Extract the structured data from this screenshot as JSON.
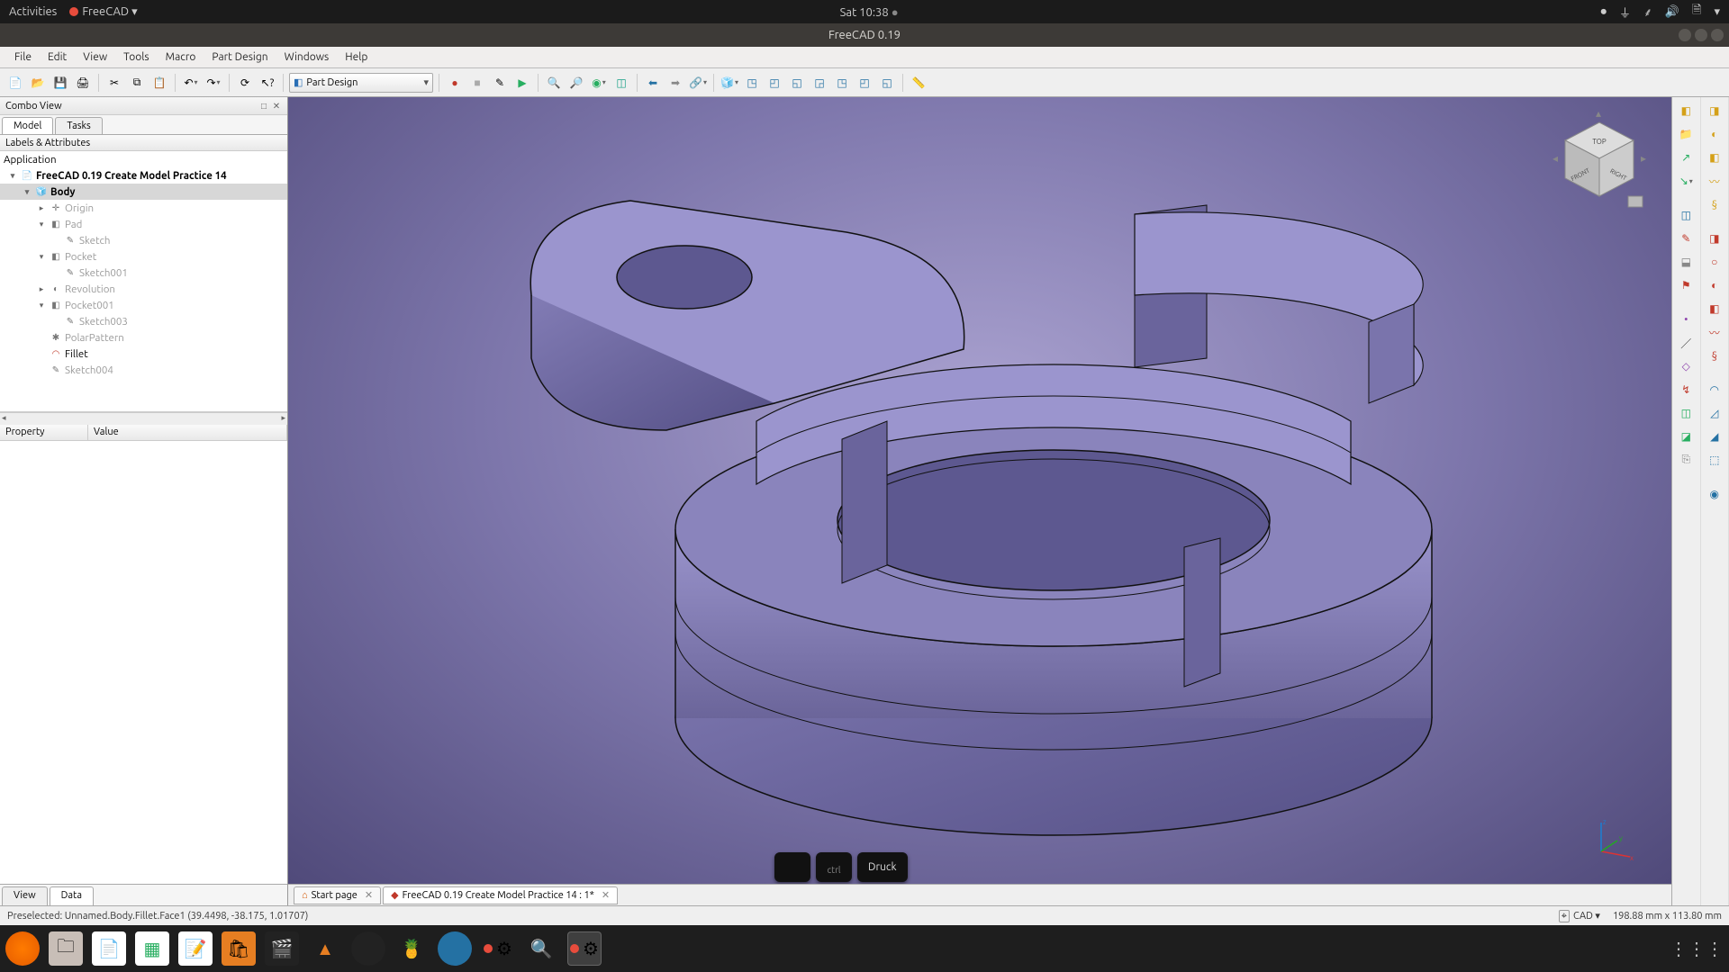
{
  "gnome": {
    "activities": "Activities",
    "app": "FreeCAD",
    "clock": "Sat 10:38"
  },
  "titlebar": {
    "title": "FreeCAD 0.19"
  },
  "menubar": [
    "File",
    "Edit",
    "View",
    "Tools",
    "Macro",
    "Part Design",
    "Windows",
    "Help"
  ],
  "workbench": {
    "selected": "Part Design"
  },
  "combo": {
    "title": "Combo View",
    "tabs": [
      "Model",
      "Tasks"
    ],
    "active_tab": 0,
    "labels_header": "Labels & Attributes",
    "application_label": "Application",
    "tree": [
      {
        "depth": 0,
        "label": "FreeCAD 0.19 Create Model Practice 14",
        "bold": true,
        "exp": "▾",
        "ico": "📄"
      },
      {
        "depth": 1,
        "label": "Body",
        "bold": true,
        "sel": true,
        "exp": "▾",
        "ico": "🧊"
      },
      {
        "depth": 2,
        "label": "Origin",
        "greyed": true,
        "exp": "▸",
        "ico": "✛"
      },
      {
        "depth": 2,
        "label": "Pad",
        "greyed": true,
        "exp": "▾",
        "ico": "◧"
      },
      {
        "depth": 3,
        "label": "Sketch",
        "greyed": true,
        "ico": "✎"
      },
      {
        "depth": 2,
        "label": "Pocket",
        "greyed": true,
        "exp": "▾",
        "ico": "◧"
      },
      {
        "depth": 3,
        "label": "Sketch001",
        "greyed": true,
        "ico": "✎"
      },
      {
        "depth": 2,
        "label": "Revolution",
        "greyed": true,
        "exp": "▸",
        "ico": "◐"
      },
      {
        "depth": 2,
        "label": "Pocket001",
        "greyed": true,
        "exp": "▾",
        "ico": "◧"
      },
      {
        "depth": 3,
        "label": "Sketch003",
        "greyed": true,
        "ico": "✎"
      },
      {
        "depth": 2,
        "label": "PolarPattern",
        "greyed": true,
        "ico": "✱"
      },
      {
        "depth": 2,
        "label": "Fillet",
        "ico": "◠",
        "color": "#c0392b"
      },
      {
        "depth": 2,
        "label": "Sketch004",
        "greyed": true,
        "ico": "✎"
      }
    ],
    "prop_cols": [
      "Property",
      "Value"
    ],
    "bottom_tabs": [
      "View",
      "Data"
    ],
    "bottom_active": 1
  },
  "view_tabs": [
    {
      "label": "Start page",
      "ico": "🏠"
    },
    {
      "label": "FreeCAD 0.19 Create Model Practice 14 : 1*",
      "ico": "📐"
    }
  ],
  "keys": [
    "",
    "ctrl",
    "Druck"
  ],
  "statusbar": {
    "left": "Preselected: Unnamed.Body.Fillet.Face1 (39.4498, -38.175, 1.01707)",
    "cad": "CAD",
    "dims": "198.88 mm x 113.80 mm"
  },
  "navcube": {
    "labels": [
      "TOP",
      "FRONT",
      "RIGHT"
    ]
  },
  "axes": {
    "x": "x",
    "y": "y",
    "z": "z"
  }
}
